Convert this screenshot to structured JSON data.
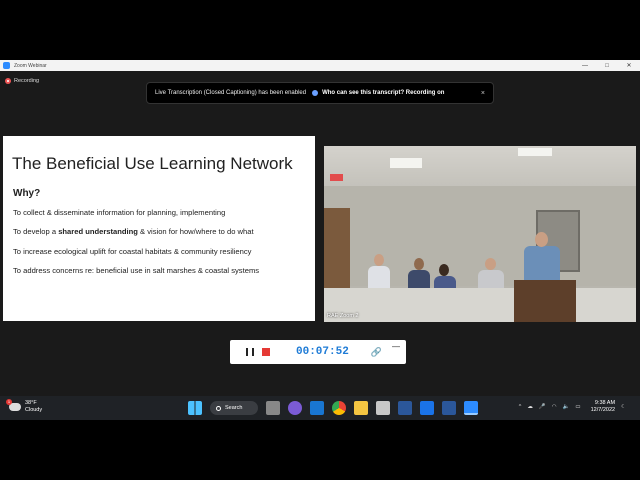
{
  "window": {
    "title": "Zoom Webinar",
    "controls": [
      "—",
      "□",
      "✕"
    ]
  },
  "recording_indicator": {
    "label": "Recording"
  },
  "transcript_notice": {
    "text": "Live Transcription (Closed Captioning) has been enabled",
    "link": "Who can see this transcript? Recording on",
    "close": "×"
  },
  "slide": {
    "title": "The Beneficial Use Learning Network",
    "heading": "Why?",
    "bullets": [
      {
        "before": "To collect & disseminate information for planning, implementing",
        "bold": "",
        "after": ""
      },
      {
        "before": "To develop a ",
        "bold": "shared understanding",
        "after": " & vision for how/where to do what"
      },
      {
        "before": "To increase ecological uplift for coastal habitats & community resiliency",
        "bold": "",
        "after": ""
      },
      {
        "before": "To address concerns re: beneficial use in salt marshes & coastal systems",
        "bold": "",
        "after": ""
      }
    ]
  },
  "video": {
    "caption": "RAE Zoom 2"
  },
  "recording_controls": {
    "timer": "00:07:52",
    "link_icon": "🔗",
    "minimize": "—"
  },
  "taskbar": {
    "weather": {
      "temp": "38°F",
      "condition": "Cloudy"
    },
    "search_label": "Search",
    "time": "9:38 AM",
    "date": "12/7/2022",
    "accent": "#1f2226"
  }
}
